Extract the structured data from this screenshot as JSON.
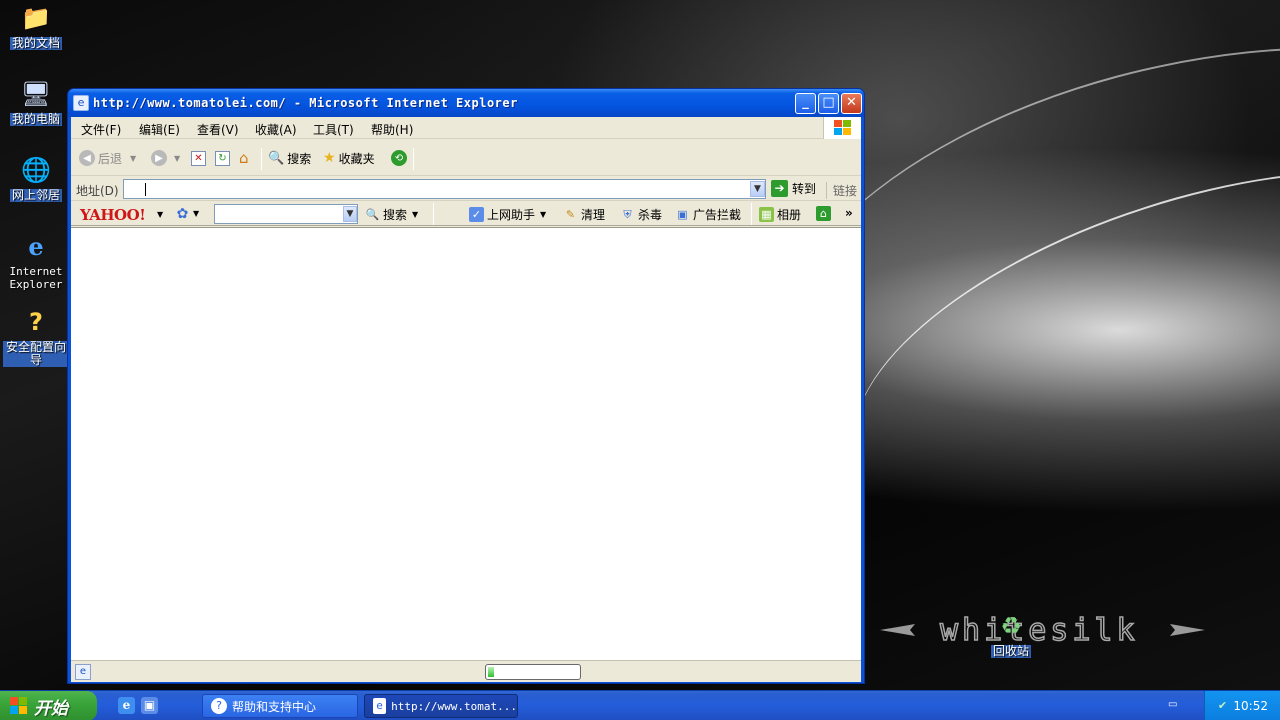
{
  "desktop": {
    "icons": [
      {
        "label": "我的文档",
        "icon": "folder-icon"
      },
      {
        "label": "我的电脑",
        "icon": "computer-icon"
      },
      {
        "label": "网上邻居",
        "icon": "network-icon"
      },
      {
        "label": "Internet Explorer",
        "icon": "ie-icon"
      },
      {
        "label": "安全配置向导",
        "icon": "security-wizard-icon"
      },
      {
        "label": "回收站",
        "icon": "recycle-bin-icon"
      }
    ],
    "wallpaper_logo": "whitesilk"
  },
  "window": {
    "title": "http://www.tomatolei.com/ - Microsoft Internet Explorer",
    "minimize": "_",
    "maximize": "□",
    "close": "✕"
  },
  "menu": {
    "items": [
      "文件(F)",
      "编辑(E)",
      "查看(V)",
      "收藏(A)",
      "工具(T)",
      "帮助(H)"
    ]
  },
  "toolbar": {
    "back": "后退",
    "search": "搜索",
    "favorites": "收藏夹"
  },
  "address": {
    "label": "地址(D)",
    "value": "",
    "go": "转到",
    "links": "链接"
  },
  "yahoo": {
    "logo": "YAHOO!",
    "search_value": "",
    "search": "搜索",
    "helper": "上网助手",
    "clean": "清理",
    "antivirus": "杀毒",
    "adblock": "广告拦截",
    "album": "相册",
    "more": "»"
  },
  "status": {
    "text": "",
    "progress": 0.05
  },
  "taskbar": {
    "start": "开始",
    "tasks": [
      {
        "label": "帮助和支持中心",
        "active": false
      },
      {
        "label": "http://www.tomat...",
        "active": true
      }
    ],
    "clock": "10:52"
  },
  "colors": {
    "titlebar": "#0454e0",
    "taskbar": "#245dda",
    "start": "#3aa53a",
    "yahoo_red": "#d01717"
  }
}
